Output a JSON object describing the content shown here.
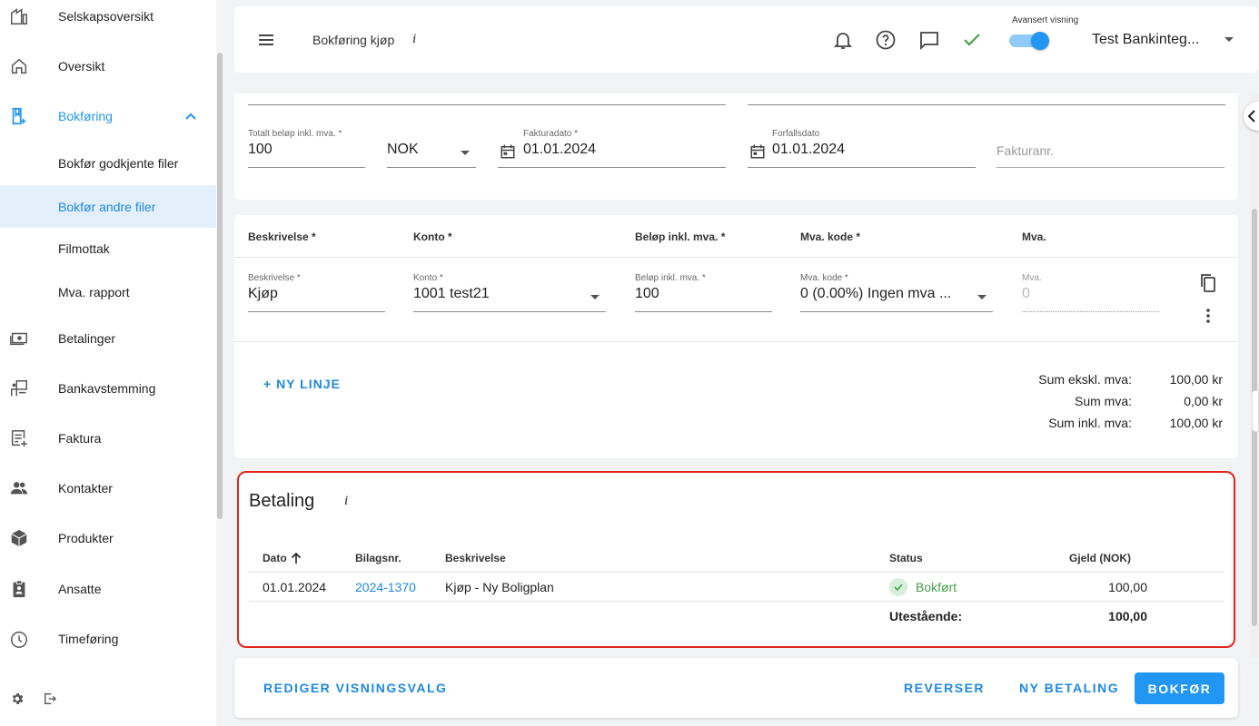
{
  "sidebar": {
    "items": [
      {
        "label": "Selskapsoversikt",
        "icon": "company-icon"
      },
      {
        "label": "Oversikt",
        "icon": "home-icon"
      },
      {
        "label": "Bokføring",
        "icon": "bookkeeping-icon"
      },
      {
        "label": "Bokfør godkjente filer"
      },
      {
        "label": "Bokfør andre filer"
      },
      {
        "label": "Filmottak"
      },
      {
        "label": "Mva. rapport"
      },
      {
        "label": "Betalinger",
        "icon": "payments-icon"
      },
      {
        "label": "Bankavstemming",
        "icon": "bank-reconciliation-icon"
      },
      {
        "label": "Faktura",
        "icon": "invoice-icon"
      },
      {
        "label": "Kontakter",
        "icon": "contacts-icon"
      },
      {
        "label": "Produkter",
        "icon": "products-icon"
      },
      {
        "label": "Ansatte",
        "icon": "employees-icon"
      },
      {
        "label": "Timeføring",
        "icon": "clock-icon"
      }
    ]
  },
  "header": {
    "title": "Bokføring kjøp",
    "info": "i",
    "toggle_label": "Avansert visning",
    "company": "Test Bankinteg..."
  },
  "invoice": {
    "total_label": "Totalt beløp inkl. mva. *",
    "total_value": "100",
    "currency": "NOK",
    "invoice_date_label": "Fakturadato *",
    "invoice_date": "01.01.2024",
    "due_date_label": "Forfallsdato",
    "due_date": "01.01.2024",
    "invoice_no_placeholder": "Fakturanr."
  },
  "lines": {
    "headers": [
      "Beskrivelse *",
      "Konto *",
      "Beløp inkl. mva. *",
      "Mva. kode *",
      "Mva."
    ],
    "row": {
      "desc_label": "Beskrivelse *",
      "desc": "Kjøp",
      "account_label": "Konto *",
      "account": "1001 test21",
      "amount_label": "Beløp inkl. mva. *",
      "amount": "100",
      "vat_code_label": "Mva. kode *",
      "vat_code": "0 (0.00%) Ingen mva ...",
      "vat_label": "Mva.",
      "vat": "0"
    },
    "add_line": "+ NY LINJE",
    "sums": [
      {
        "label": "Sum ekskl. mva:",
        "value": "100,00 kr"
      },
      {
        "label": "Sum mva:",
        "value": "0,00 kr"
      },
      {
        "label": "Sum inkl. mva:",
        "value": "100,00 kr"
      }
    ]
  },
  "payment": {
    "title": "Betaling",
    "info": "i",
    "headers": {
      "date": "Dato",
      "voucher": "Bilagsnr.",
      "desc": "Beskrivelse",
      "status": "Status",
      "debt": "Gjeld (NOK)"
    },
    "row": {
      "date": "01.01.2024",
      "voucher": "2024-1370",
      "desc": "Kjøp - Ny Boligplan",
      "status": "Bokført",
      "debt": "100,00"
    },
    "outstanding_label": "Utestående:",
    "outstanding_value": "100,00"
  },
  "footer": {
    "edit_view": "REDIGER VISNINGSVALG",
    "reverse": "REVERSER",
    "new_payment": "NY BETALING",
    "post": "BOKFØR"
  },
  "colors": {
    "accent": "#2196f3",
    "highlight_border": "#e0261c",
    "success": "#43a047"
  }
}
